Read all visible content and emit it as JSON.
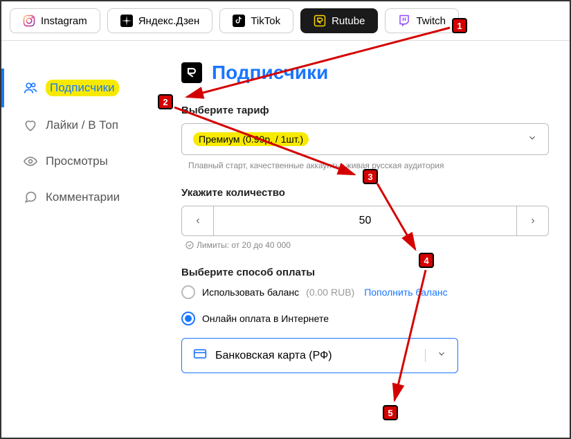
{
  "tabs": {
    "instagram": "Instagram",
    "yandex": "Яндекс.Дзен",
    "tiktok": "TikTok",
    "rutube": "Rutube",
    "twitch": "Twitch"
  },
  "sidebar": {
    "subscribers": "Подписчики",
    "likes": "Лайки / В Топ",
    "views": "Просмотры",
    "comments": "Комментарии"
  },
  "heading": "Подписчики",
  "tariff": {
    "label": "Выберите тариф",
    "value": "Премиум (0.99р. / 1шт.)",
    "hint": "Плавный старт, качественные аккаунты, живая русская аудитория"
  },
  "quantity": {
    "label": "Укажите количество",
    "value": "50",
    "limits": "Лимиты: от 20 до 40 000"
  },
  "payment": {
    "label": "Выберите способ оплаты",
    "balance_label": "Использовать баланс",
    "balance_amount": "(0.00 RUB)",
    "topup": "Пополнить баланс",
    "online_label": "Онлайн оплата в Интернете",
    "method": "Банковская карта (РФ)"
  },
  "badges": {
    "b1": "1",
    "b2": "2",
    "b3": "3",
    "b4": "4",
    "b5": "5"
  }
}
